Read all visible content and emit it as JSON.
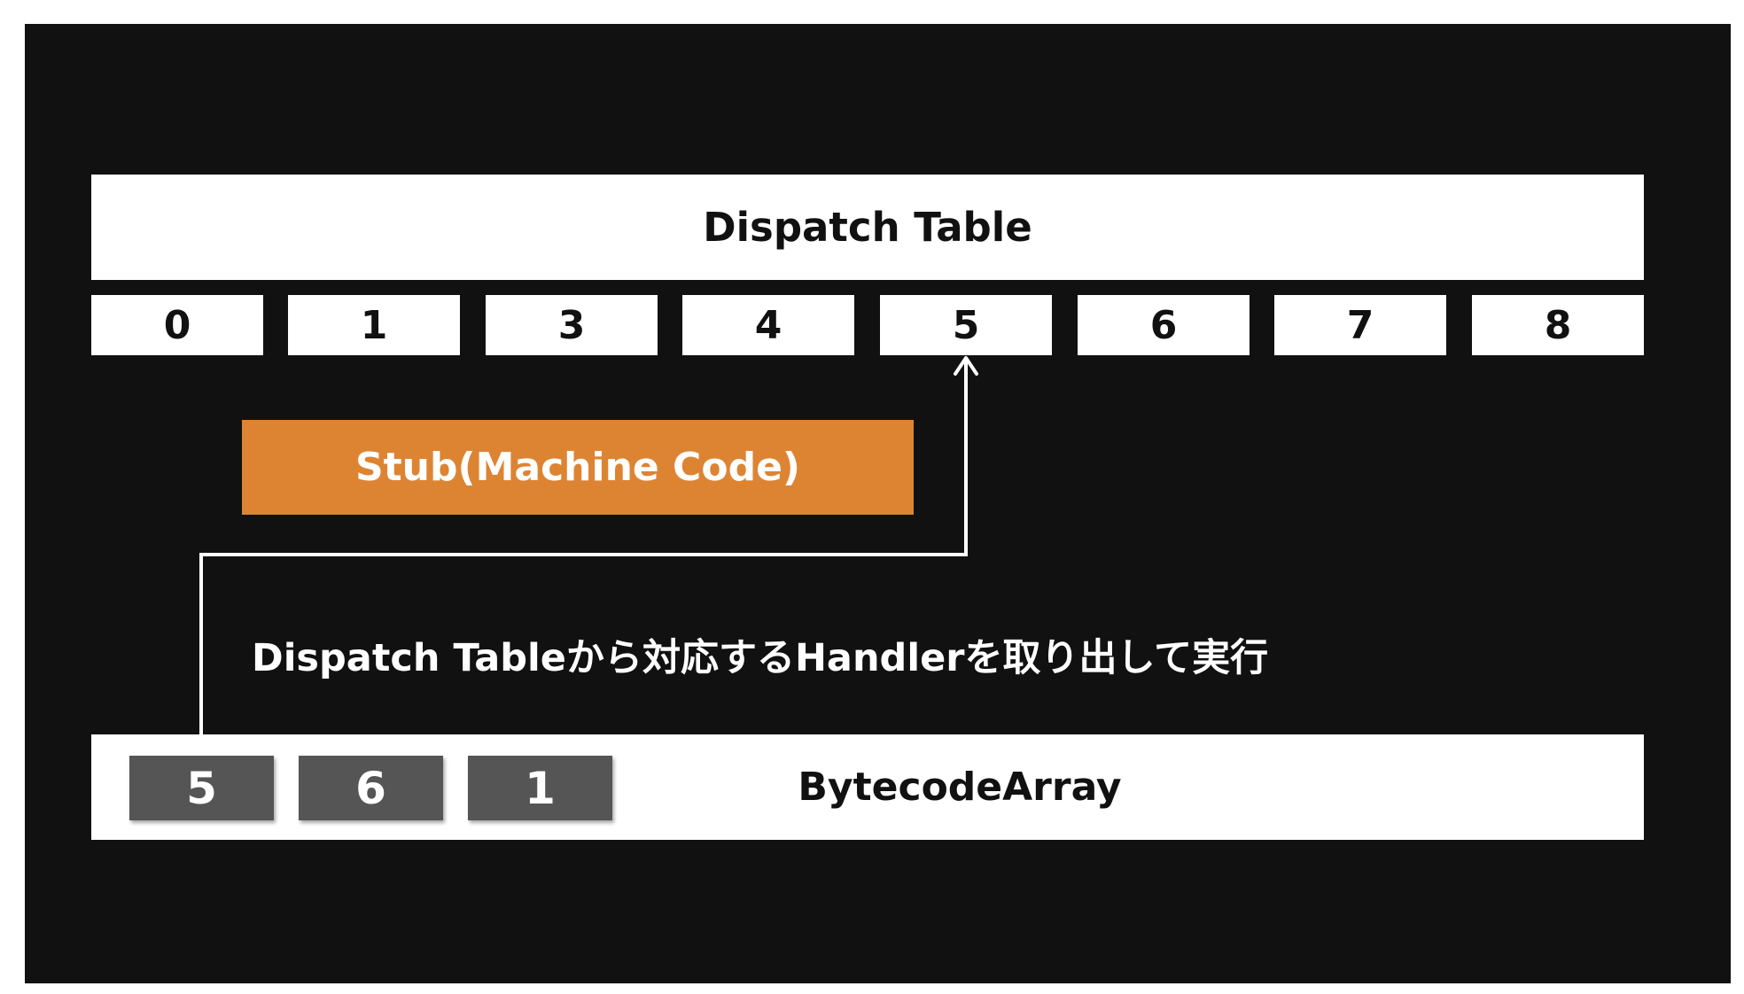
{
  "dispatch_table": {
    "title": "Dispatch Table",
    "indices": [
      "0",
      "1",
      "3",
      "4",
      "5",
      "6",
      "7",
      "8"
    ]
  },
  "stub": {
    "label": "Stub(Machine Code)",
    "color": "#dd8433"
  },
  "caption": "Dispatch Tableから対応するHandlerを取り出して実行",
  "bytecode_array": {
    "label": "BytecodeArray",
    "bytes": [
      "5",
      "6",
      "1"
    ]
  },
  "colors": {
    "background": "#111111",
    "box": "#ffffff",
    "byte_fill": "#555555"
  },
  "connector": {
    "from": "bytecode-byte-5",
    "to": "dispatch-cell-5",
    "icon": "arrow-up-icon"
  }
}
